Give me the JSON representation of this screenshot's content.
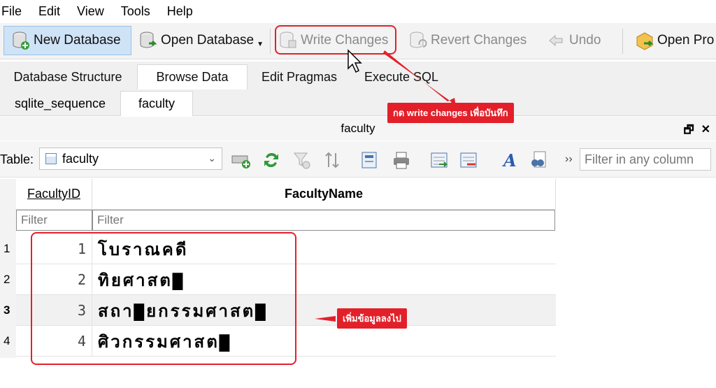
{
  "menu": [
    "File",
    "Edit",
    "View",
    "Tools",
    "Help"
  ],
  "toolbar": {
    "new_db": "New Database",
    "open_db": "Open Database",
    "write_changes": "Write Changes",
    "revert_changes": "Revert Changes",
    "undo": "Undo",
    "open_project": "Open Pro"
  },
  "main_tabs": [
    "Database Structure",
    "Browse Data",
    "Edit Pragmas",
    "Execute SQL"
  ],
  "sub_tabs": [
    "sqlite_sequence",
    "faculty"
  ],
  "dock_title": "faculty",
  "table_bar": {
    "label": "Table:",
    "selected_table": "faculty",
    "filter_placeholder": "Filter in any column"
  },
  "grid": {
    "columns": [
      "FacultyID",
      "FacultyName"
    ],
    "filter_placeholder": "Filter",
    "rows": [
      {
        "num": "1",
        "id": "1",
        "name": "โบราณคดี"
      },
      {
        "num": "2",
        "id": "2",
        "name": "ทิยศาสต▇"
      },
      {
        "num": "3",
        "id": "3",
        "name": "สถา▇ยกรรมศาสต▇"
      },
      {
        "num": "4",
        "id": "4",
        "name": "ศิวกรรมศาสต▇"
      }
    ]
  },
  "annotations": {
    "write_callout": "กด write changes เพื่อบันทึก",
    "data_callout": "เพิ่มข้อมูลลงไป"
  },
  "colors": {
    "highlight": "#e3202a",
    "active_button": "#cfe3f7"
  }
}
